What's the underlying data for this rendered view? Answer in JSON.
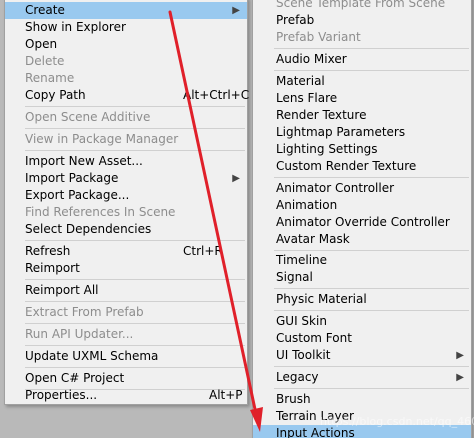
{
  "left_menu": {
    "create": "Create",
    "show_in_explorer": "Show in Explorer",
    "open": "Open",
    "delete": "Delete",
    "rename": "Rename",
    "copy_path": "Copy Path",
    "copy_path_shortcut": "Alt+Ctrl+C",
    "open_scene_additive": "Open Scene Additive",
    "view_in_package_manager": "View in Package Manager",
    "import_new_asset": "Import New Asset...",
    "import_package": "Import Package",
    "export_package": "Export Package...",
    "find_references": "Find References In Scene",
    "select_dependencies": "Select Dependencies",
    "refresh": "Refresh",
    "refresh_shortcut": "Ctrl+R",
    "reimport": "Reimport",
    "reimport_all": "Reimport All",
    "extract_from_prefab": "Extract From Prefab",
    "run_api_updater": "Run API Updater...",
    "update_uxml_schema": "Update UXML Schema",
    "open_csharp_project": "Open C# Project",
    "properties": "Properties...",
    "properties_shortcut": "Alt+P"
  },
  "right_menu": {
    "scene_template": "Scene Template From Scene",
    "prefab": "Prefab",
    "prefab_variant": "Prefab Variant",
    "audio_mixer": "Audio Mixer",
    "material": "Material",
    "lens_flare": "Lens Flare",
    "render_texture": "Render Texture",
    "lightmap_parameters": "Lightmap Parameters",
    "lighting_settings": "Lighting Settings",
    "custom_render_texture": "Custom Render Texture",
    "animator_controller": "Animator Controller",
    "animation": "Animation",
    "animator_override_controller": "Animator Override Controller",
    "avatar_mask": "Avatar Mask",
    "timeline": "Timeline",
    "signal": "Signal",
    "physic_material": "Physic Material",
    "gui_skin": "GUI Skin",
    "custom_font": "Custom Font",
    "ui_toolkit": "UI Toolkit",
    "legacy": "Legacy",
    "brush": "Brush",
    "terrain_layer": "Terrain Layer",
    "input_actions": "Input Actions"
  },
  "watermark": "https://blog.csdn.net/qq_46013696",
  "colors": {
    "menu_bg": "#f0f0f0",
    "highlight": "#99c9ef",
    "disabled_text": "#8d8d8d",
    "annotation_arrow": "#e0202a"
  },
  "icons": {
    "submenu": "▶"
  }
}
